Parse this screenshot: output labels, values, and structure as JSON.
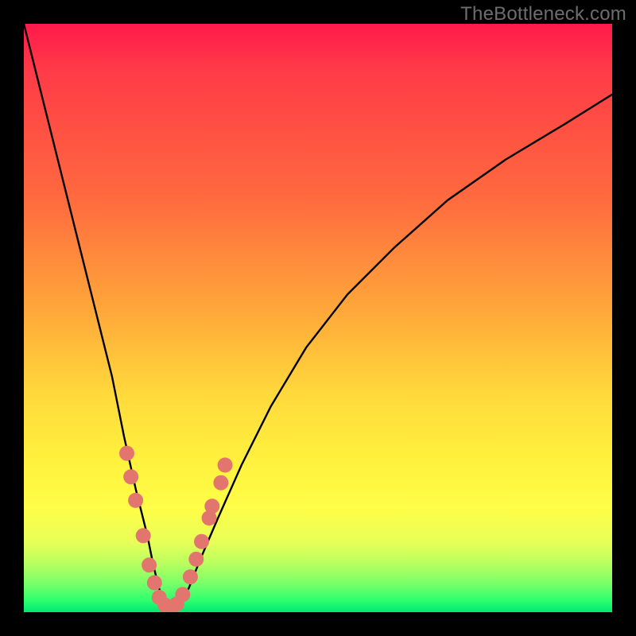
{
  "watermark": "TheBottleneck.com",
  "chart_data": {
    "type": "line",
    "title": "",
    "xlabel": "",
    "ylabel": "",
    "xlim": [
      0,
      100
    ],
    "ylim": [
      0,
      100
    ],
    "series": [
      {
        "name": "bottleneck-curve",
        "x": [
          0,
          3,
          6,
          9,
          12,
          15,
          17,
          19,
          21,
          22,
          23,
          24,
          25,
          26,
          28,
          30,
          33,
          37,
          42,
          48,
          55,
          63,
          72,
          82,
          92,
          100
        ],
        "y": [
          100,
          88,
          76,
          64,
          52,
          40,
          30,
          21,
          13,
          8,
          4,
          1,
          0,
          1,
          4,
          9,
          16,
          25,
          35,
          45,
          54,
          62,
          70,
          77,
          83,
          88
        ]
      }
    ],
    "markers": {
      "name": "highlight-dots",
      "color": "#e2766e",
      "points": [
        {
          "x": 17.5,
          "y": 27
        },
        {
          "x": 18.2,
          "y": 23
        },
        {
          "x": 19.0,
          "y": 19
        },
        {
          "x": 20.3,
          "y": 13
        },
        {
          "x": 21.3,
          "y": 8
        },
        {
          "x": 22.2,
          "y": 5
        },
        {
          "x": 23.0,
          "y": 2.5
        },
        {
          "x": 24.0,
          "y": 1.2
        },
        {
          "x": 25.0,
          "y": 0.8
        },
        {
          "x": 26.0,
          "y": 1.4
        },
        {
          "x": 27.0,
          "y": 3
        },
        {
          "x": 28.3,
          "y": 6
        },
        {
          "x": 29.3,
          "y": 9
        },
        {
          "x": 30.2,
          "y": 12
        },
        {
          "x": 31.5,
          "y": 16
        },
        {
          "x": 32.0,
          "y": 18
        },
        {
          "x": 33.5,
          "y": 22
        },
        {
          "x": 34.2,
          "y": 25
        }
      ]
    },
    "background_gradient": {
      "top": "#ff1a4b",
      "mid_upper": "#ff8a3c",
      "mid": "#ffe33c",
      "mid_lower": "#d8ff55",
      "bottom": "#00e874"
    }
  }
}
